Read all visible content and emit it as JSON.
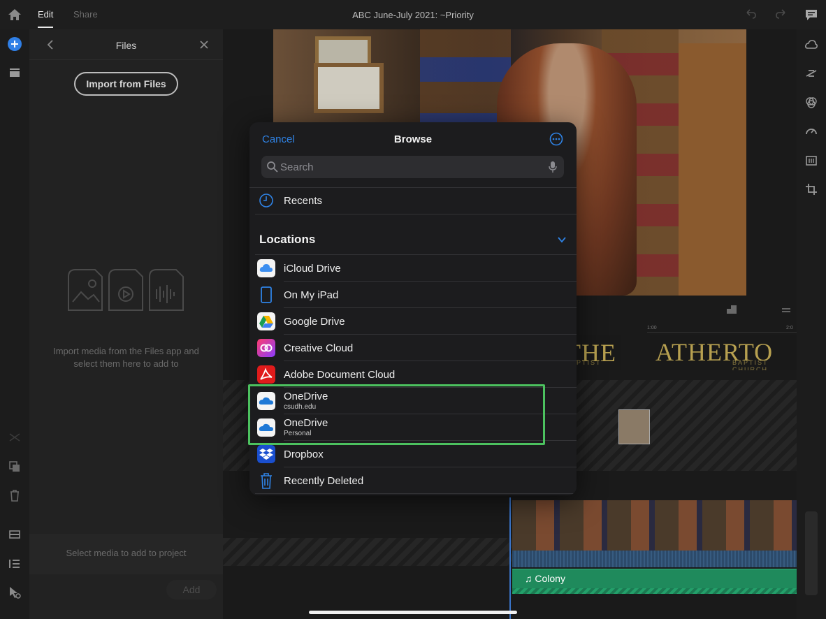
{
  "top_bar": {
    "tabs": [
      {
        "label": "Edit",
        "active": true
      },
      {
        "label": "Share",
        "active": false
      }
    ],
    "project_title": "ABC June-July 2021: ~Priority",
    "icons": [
      "home-icon",
      "undo-icon",
      "redo-icon",
      "feedback-icon"
    ]
  },
  "left_rail": {
    "icons": [
      "add-media-icon",
      "project-panel-icon",
      "split-icon",
      "duplicate-icon",
      "trash-icon",
      "titles-icon",
      "list-icon",
      "cursor-add-icon"
    ],
    "accent": "#2f7fe6"
  },
  "files_panel": {
    "title": "Files",
    "import_button": "Import from Files",
    "hint": "Import media from the Files app and select them here to add to",
    "select_text": "Select media to add to project",
    "add_button": "Add"
  },
  "browse": {
    "cancel": "Cancel",
    "title": "Browse",
    "search_placeholder": "Search",
    "recents": "Recents",
    "locations_header": "Locations",
    "locations": [
      {
        "label": "iCloud Drive",
        "sub": "",
        "icon": "icloud-icon"
      },
      {
        "label": "On My iPad",
        "sub": "",
        "icon": "ipad-icon"
      },
      {
        "label": "Google Drive",
        "sub": "",
        "icon": "google-drive-icon"
      },
      {
        "label": "Creative Cloud",
        "sub": "",
        "icon": "creative-cloud-icon"
      },
      {
        "label": "Adobe Document Cloud",
        "sub": "",
        "icon": "adobe-document-cloud-icon"
      },
      {
        "label": "OneDrive",
        "sub": "csudh.edu",
        "icon": "onedrive-icon"
      },
      {
        "label": "OneDrive",
        "sub": "Personal",
        "icon": "onedrive-icon"
      },
      {
        "label": "Dropbox",
        "sub": "",
        "icon": "dropbox-icon"
      },
      {
        "label": "Recently Deleted",
        "sub": "",
        "icon": "trash-icon"
      }
    ],
    "accent": "#2f83e6",
    "highlight_color": "#4cc15f"
  },
  "timeline": {
    "title_text": "ATHERTO",
    "title_text_partial": "THE",
    "subtitle_partial": "APTIST",
    "subtitle": "BAPTIST CHURCH",
    "ruler_marks": [
      "1:00",
      "2:0"
    ],
    "audio_clip": "Colony"
  }
}
